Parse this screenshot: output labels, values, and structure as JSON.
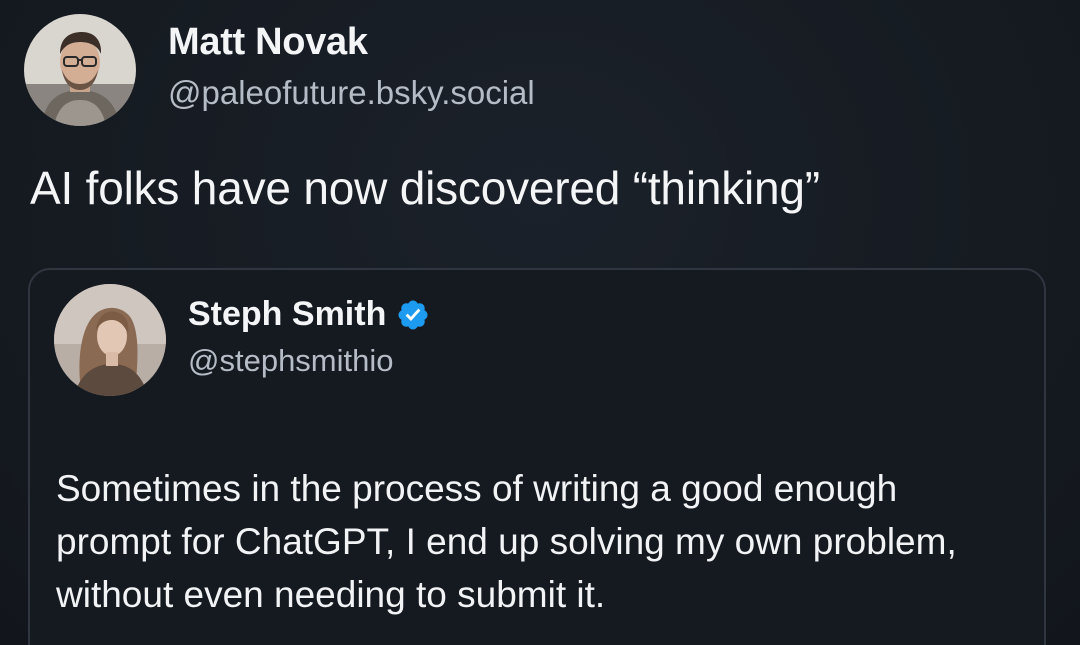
{
  "post": {
    "author": {
      "name": "Matt Novak",
      "handle": "@paleofuture.bsky.social"
    },
    "text": "AI folks have now discovered “thinking”"
  },
  "quoted_post": {
    "author": {
      "name": "Steph Smith",
      "handle": "@stephsmithio",
      "verified": true
    },
    "text": "Sometimes in the process of writing a good enough prompt for ChatGPT, I end up solving my own problem, without even needing to submit it."
  },
  "colors": {
    "background": "#161b22",
    "text_primary": "#f3f5f7",
    "text_secondary": "#b5bcc6",
    "card_border": "#2f3640",
    "verified_badge": "#1d9bf0"
  },
  "icons": {
    "verified": "verified-badge-icon"
  }
}
